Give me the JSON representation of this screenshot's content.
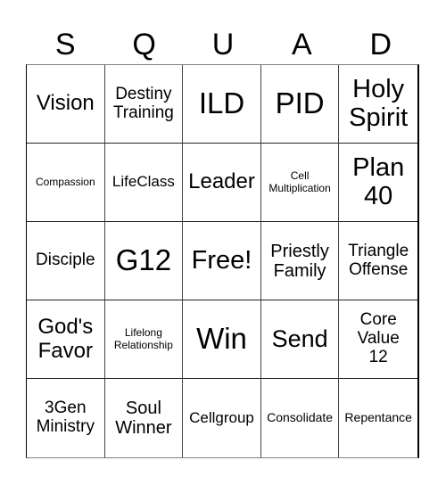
{
  "header": [
    "S",
    "Q",
    "U",
    "A",
    "D"
  ],
  "cells": [
    {
      "text": "Vision",
      "size": "s24"
    },
    {
      "text": "Destiny\nTraining",
      "size": "s19"
    },
    {
      "text": "ILD",
      "size": "s33"
    },
    {
      "text": "PID",
      "size": "s33"
    },
    {
      "text": "Holy\nSpirit",
      "size": "s29"
    },
    {
      "text": "Compassion",
      "size": "s12"
    },
    {
      "text": "LifeClass",
      "size": "s17"
    },
    {
      "text": "Leader",
      "size": "s24"
    },
    {
      "text": "Cell\nMultiplication",
      "size": "s12"
    },
    {
      "text": "Plan\n40",
      "size": "s29"
    },
    {
      "text": "Disciple",
      "size": "s19"
    },
    {
      "text": "G12",
      "size": "s33"
    },
    {
      "text": "Free!",
      "size": "s29"
    },
    {
      "text": "Priestly\nFamily",
      "size": "s20"
    },
    {
      "text": "Triangle\nOffense",
      "size": "s19"
    },
    {
      "text": "God's\nFavor",
      "size": "s24"
    },
    {
      "text": "Lifelong\nRelationship",
      "size": "s12"
    },
    {
      "text": "Win",
      "size": "s33"
    },
    {
      "text": "Send",
      "size": "s27"
    },
    {
      "text": "Core\nValue\n12",
      "size": "s19"
    },
    {
      "text": "3Gen\nMinistry",
      "size": "s19"
    },
    {
      "text": "Soul\nWinner",
      "size": "s20"
    },
    {
      "text": "Cellgroup",
      "size": "s17"
    },
    {
      "text": "Consolidate",
      "size": "s14"
    },
    {
      "text": "Repentance",
      "size": "s14"
    }
  ]
}
